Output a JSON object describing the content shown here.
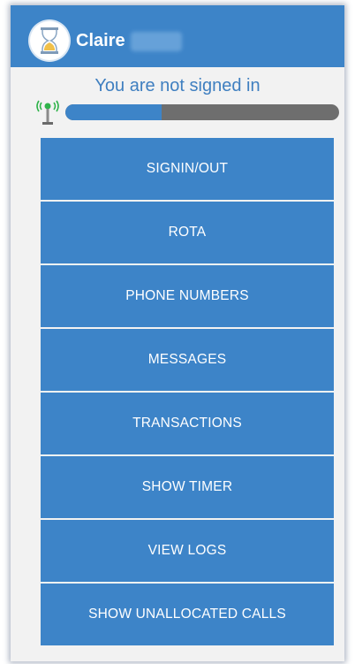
{
  "app_bar": {
    "title": "Claire",
    "logo_icon": "hourglass-icon",
    "background_color": "#3d84c8"
  },
  "status": {
    "text": "You are not signed in",
    "signal_icon": "antenna-signal-icon",
    "progress_fraction": 0.35
  },
  "menu": {
    "items": [
      {
        "label": "SIGNIN/OUT"
      },
      {
        "label": "ROTA"
      },
      {
        "label": "PHONE NUMBERS"
      },
      {
        "label": "MESSAGES"
      },
      {
        "label": "TRANSACTIONS"
      },
      {
        "label": "SHOW TIMER"
      },
      {
        "label": "VIEW LOGS"
      },
      {
        "label": "SHOW UNALLOCATED CALLS"
      }
    ]
  }
}
